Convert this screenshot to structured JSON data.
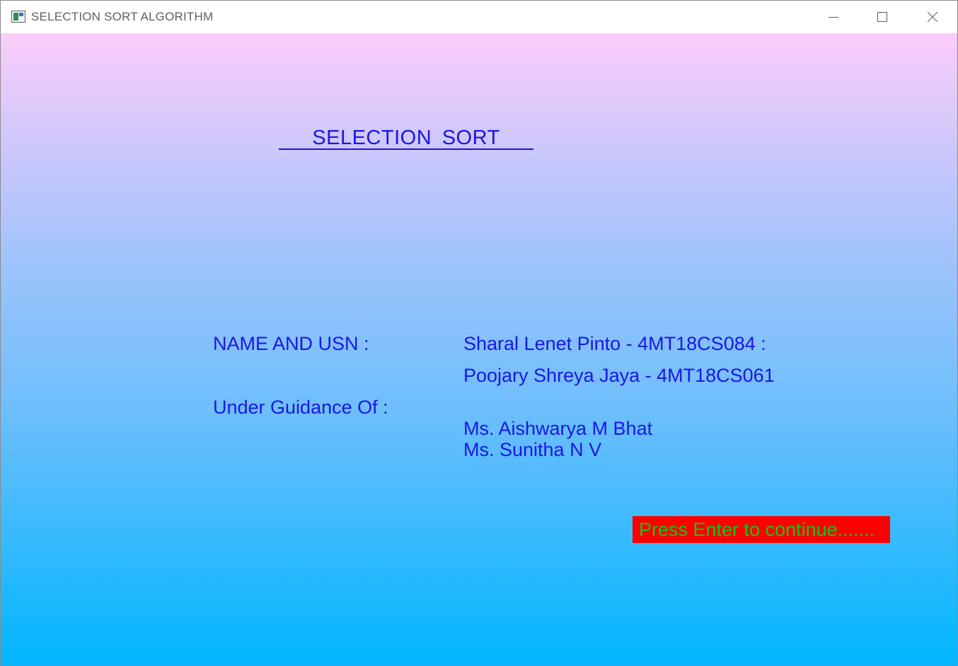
{
  "window": {
    "title": "SELECTION SORT ALGORITHM",
    "icon": "application-window-icon",
    "controls": [
      "minimize-icon",
      "maximize-icon",
      "close-icon"
    ]
  },
  "screen": {
    "heading": "SELECTION  SORT",
    "name_usn_label": "NAME AND USN :",
    "students": [
      "Sharal Lenet Pinto - 4MT18CS084 :",
      "Poojary Shreya Jaya - 4MT18CS061"
    ],
    "guidance_label": "Under Guidance Of :",
    "guides": [
      "Ms. Aishwarya M Bhat",
      "Ms. Sunitha N V"
    ],
    "continue_prompt": "Press Enter to continue......."
  },
  "colors": {
    "text": "#1a16e6",
    "gradient_top": "#fbccfb",
    "gradient_bottom": "#00b6fe",
    "prompt_background": "#ff0000",
    "prompt_text": "#18c418"
  }
}
